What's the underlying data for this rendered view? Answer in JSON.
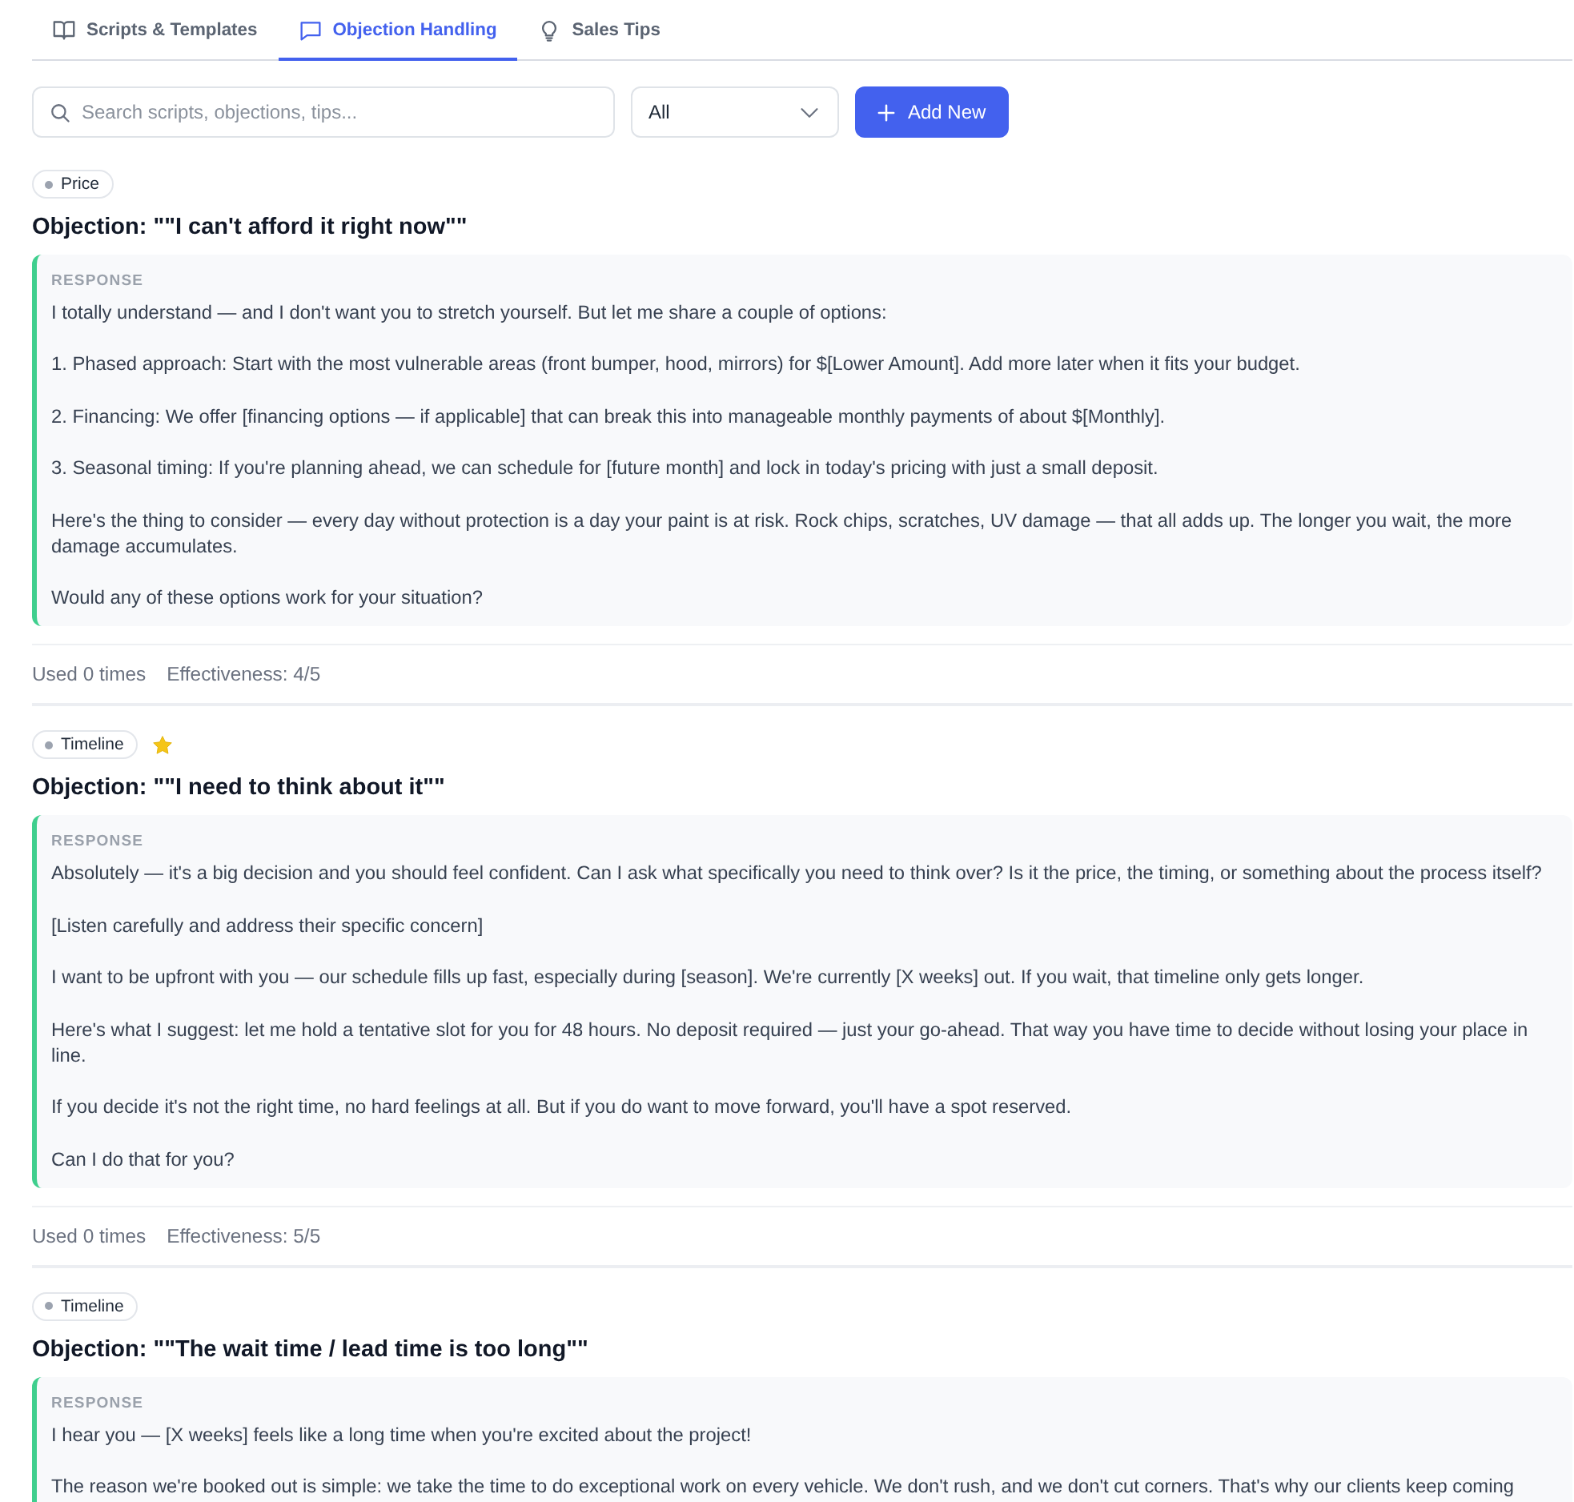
{
  "tabs": [
    {
      "label": "Scripts & Templates",
      "selected": false
    },
    {
      "label": "Objection Handling",
      "selected": true
    },
    {
      "label": "Sales Tips",
      "selected": false
    }
  ],
  "toolbar": {
    "search": {
      "placeholder": "Search scripts, objections, tips..."
    },
    "filter": {
      "value": "All"
    },
    "add_button": "Add New"
  },
  "objections": [
    {
      "tag": "Price",
      "favorite": false,
      "title": "Objection: \"\"I can't afford it right now\"\"",
      "response_label": "RESPONSE",
      "response": [
        "I totally understand — and I don't want you to stretch yourself. But let me share a couple of options:",
        "1. Phased approach: Start with the most vulnerable areas (front bumper, hood, mirrors) for $[Lower Amount]. Add more later when it fits your budget.",
        "2. Financing: We offer [financing options — if applicable] that can break this into manageable monthly payments of about $[Monthly].",
        "3. Seasonal timing: If you're planning ahead, we can schedule for [future month] and lock in today's pricing with just a small deposit.",
        "Here's the thing to consider — every day without protection is a day your paint is at risk. Rock chips, scratches, UV damage — that all adds up. The longer you wait, the more damage accumulates.",
        "Would any of these options work for your situation?"
      ],
      "used": "Used 0 times",
      "effectiveness": "Effectiveness: 4/5"
    },
    {
      "tag": "Timeline",
      "favorite": true,
      "title": "Objection: \"\"I need to think about it\"\"",
      "response_label": "RESPONSE",
      "response": [
        "Absolutely — it's a big decision and you should feel confident. Can I ask what specifically you need to think over? Is it the price, the timing, or something about the process itself?",
        "[Listen carefully and address their specific concern]",
        "I want to be upfront with you — our schedule fills up fast, especially during [season]. We're currently [X weeks] out. If you wait, that timeline only gets longer.",
        "Here's what I suggest: let me hold a tentative slot for you for 48 hours. No deposit required — just your go-ahead. That way you have time to decide without losing your place in line.",
        "If you decide it's not the right time, no hard feelings at all. But if you do want to move forward, you'll have a spot reserved.",
        "Can I do that for you?"
      ],
      "used": "Used 0 times",
      "effectiveness": "Effectiveness: 5/5"
    },
    {
      "tag": "Timeline",
      "favorite": false,
      "title": "Objection: \"\"The wait time / lead time is too long\"\"",
      "response_label": "RESPONSE",
      "response": [
        "I hear you — [X weeks] feels like a long time when you're excited about the project!",
        "The reason we're booked out is simple: we take the time to do exceptional work on every vehicle. We don't rush, and we don't cut corners. That's why our clients keep coming"
      ]
    }
  ]
}
